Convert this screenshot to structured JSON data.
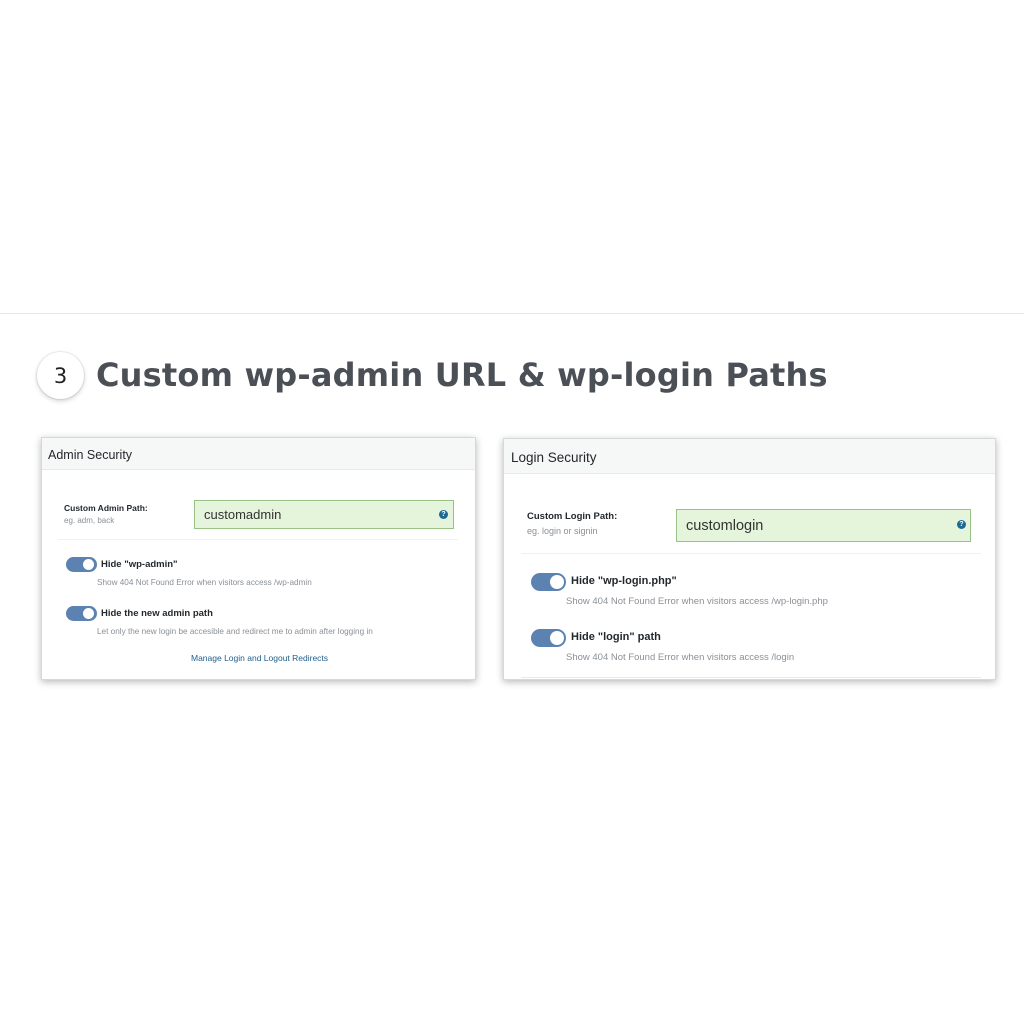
{
  "section": {
    "step_number": "3",
    "heading": "Custom wp-admin URL & wp-login Paths"
  },
  "admin_panel": {
    "title": "Admin Security",
    "path_field": {
      "label": "Custom Admin Path:",
      "hint": "eg. adm, back",
      "value": "customadmin",
      "help_icon": "question-icon"
    },
    "toggles": [
      {
        "title": "Hide \"wp-admin\"",
        "description": "Show 404 Not Found Error when visitors access /wp-admin",
        "enabled": true
      },
      {
        "title": "Hide the new admin path",
        "description": "Let only the new login be accesible and redirect me to admin after logging in",
        "enabled": true
      }
    ],
    "link": "Manage Login and Logout Redirects"
  },
  "login_panel": {
    "title": "Login Security",
    "path_field": {
      "label": "Custom Login Path:",
      "hint": "eg. login or signin",
      "value": "customlogin",
      "help_icon": "question-icon"
    },
    "toggles": [
      {
        "title": "Hide \"wp-login.php\"",
        "description": "Show 404 Not Found Error when visitors access /wp-login.php",
        "enabled": true
      },
      {
        "title": "Hide \"login\" path",
        "description": "Show 404 Not Found Error when visitors access /login",
        "enabled": true
      }
    ]
  },
  "colors": {
    "toggle_on": "#5b82b0",
    "input_background": "#e5f5dc",
    "input_border": "#9ac286",
    "link": "#1f5e8c",
    "heading": "#4b4f56"
  }
}
